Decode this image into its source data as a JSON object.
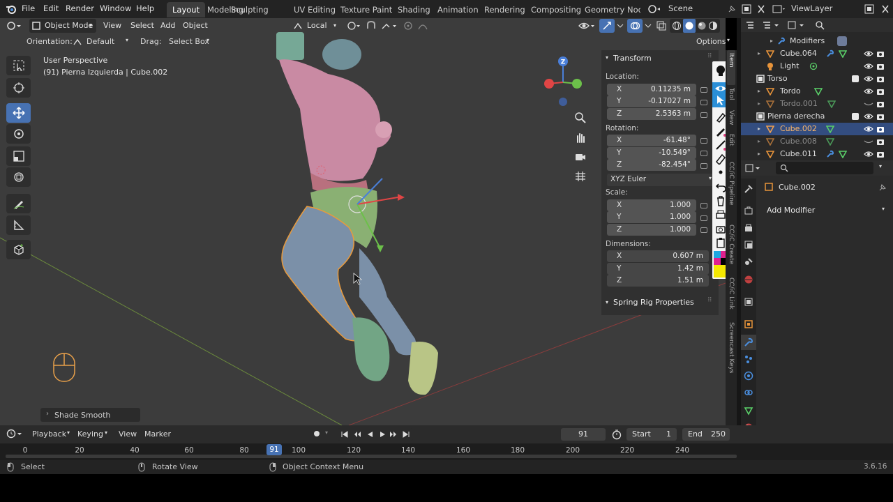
{
  "menubar": {
    "items": [
      "File",
      "Edit",
      "Render",
      "Window",
      "Help"
    ],
    "workspaces": [
      "Layout",
      "Modeling",
      "Sculpting",
      "UV Editing",
      "Texture Paint",
      "Shading",
      "Animation",
      "Rendering",
      "Compositing",
      "Geometry Node"
    ],
    "active_workspace": "Layout",
    "scene": "Scene",
    "view_layer": "ViewLayer"
  },
  "viewport_header": {
    "mode": "Object Mode",
    "menus": [
      "View",
      "Select",
      "Add",
      "Object"
    ],
    "transform_orientation": "Local"
  },
  "tool_settings": {
    "orientation_label": "Orientation:",
    "orientation_value": "Default",
    "drag_label": "Drag:",
    "drag_value": "Select Box",
    "options": "Options"
  },
  "viewport": {
    "perspective": "User Perspective",
    "context": "(91) Pierna Izquierda | Cube.002",
    "last_op": "Shade Smooth",
    "gizmo_axes": [
      "Z"
    ]
  },
  "transform_panel": {
    "title": "Transform",
    "location_label": "Location:",
    "location": [
      {
        "axis": "X",
        "value": "0.11235 m"
      },
      {
        "axis": "Y",
        "value": "-0.17027 m"
      },
      {
        "axis": "Z",
        "value": "2.5363 m"
      }
    ],
    "rotation_label": "Rotation:",
    "rotation": [
      {
        "axis": "X",
        "value": "-61.48°"
      },
      {
        "axis": "Y",
        "value": "-10.549°"
      },
      {
        "axis": "Z",
        "value": "-82.454°"
      }
    ],
    "rotation_mode": "XYZ Euler",
    "scale_label": "Scale:",
    "scale": [
      {
        "axis": "X",
        "value": "1.000"
      },
      {
        "axis": "Y",
        "value": "1.000"
      },
      {
        "axis": "Z",
        "value": "1.000"
      }
    ],
    "dimensions_label": "Dimensions:",
    "dimensions": [
      {
        "axis": "X",
        "value": "0.607 m"
      },
      {
        "axis": "Y",
        "value": "1.42 m"
      },
      {
        "axis": "Z",
        "value": "1.51 m"
      }
    ],
    "spring_rig": "Spring Rig Properties"
  },
  "vertical_tabs": [
    "Item",
    "Tool",
    "View",
    "Edit",
    "CC/iC Pipeline",
    "CC/iC Create",
    "CC/iC Link",
    "Screencast Keys"
  ],
  "outliner": {
    "rows": [
      {
        "name": "Modifiers",
        "selected": false,
        "dim": false
      },
      {
        "name": "Cube.064",
        "selected": false,
        "dim": false
      },
      {
        "name": "Light",
        "selected": false,
        "dim": false
      },
      {
        "name": "Torso",
        "selected": false,
        "dim": false
      },
      {
        "name": "Tordo",
        "selected": false,
        "dim": false
      },
      {
        "name": "Tordo.001",
        "selected": false,
        "dim": true
      },
      {
        "name": "Pierna derecha",
        "selected": false,
        "dim": false
      },
      {
        "name": "Cube.002",
        "selected": true,
        "dim": false
      },
      {
        "name": "Cube.008",
        "selected": false,
        "dim": true
      },
      {
        "name": "Cube.011",
        "selected": false,
        "dim": false
      }
    ]
  },
  "properties": {
    "object_name": "Cube.002",
    "add_modifier": "Add Modifier"
  },
  "timeline": {
    "menus": [
      "Playback",
      "Keying",
      "View",
      "Marker"
    ],
    "current_frame": "91",
    "start_label": "Start",
    "start": "1",
    "end_label": "End",
    "end": "250",
    "ticks": [
      "0",
      "20",
      "40",
      "60",
      "80",
      "100",
      "120",
      "140",
      "160",
      "180",
      "200",
      "220",
      "240"
    ]
  },
  "statusbar": {
    "select": "Select",
    "rotate": "Rotate View",
    "context_menu": "Object Context Menu",
    "version": "3.6.16"
  }
}
